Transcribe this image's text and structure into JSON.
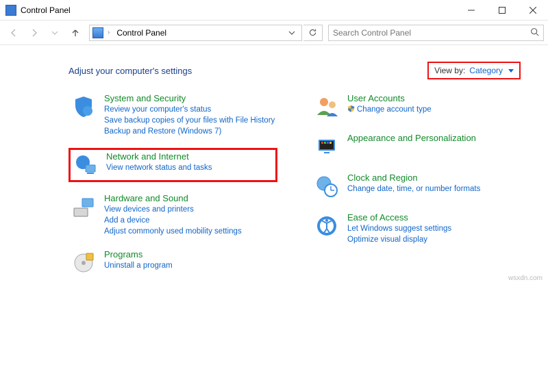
{
  "window": {
    "title": "Control Panel"
  },
  "breadcrumb": {
    "root": "Control Panel"
  },
  "search": {
    "placeholder": "Search Control Panel"
  },
  "header": {
    "title": "Adjust your computer's settings"
  },
  "viewby": {
    "label": "View by:",
    "value": "Category"
  },
  "left": [
    {
      "id": "system-security",
      "title": "System and Security",
      "links": [
        "Review your computer's status",
        "Save backup copies of your files with File History",
        "Backup and Restore (Windows 7)"
      ],
      "highlighted": false
    },
    {
      "id": "network-internet",
      "title": "Network and Internet",
      "links": [
        "View network status and tasks"
      ],
      "highlighted": true
    },
    {
      "id": "hardware-sound",
      "title": "Hardware and Sound",
      "links": [
        "View devices and printers",
        "Add a device",
        "Adjust commonly used mobility settings"
      ],
      "highlighted": false
    },
    {
      "id": "programs",
      "title": "Programs",
      "links": [
        "Uninstall a program"
      ],
      "highlighted": false
    }
  ],
  "right": [
    {
      "id": "user-accounts",
      "title": "User Accounts",
      "links": [
        "Change account type"
      ]
    },
    {
      "id": "appearance-personalization",
      "title": "Appearance and Personalization",
      "links": []
    },
    {
      "id": "clock-region",
      "title": "Clock and Region",
      "links": [
        "Change date, time, or number formats"
      ]
    },
    {
      "id": "ease-of-access",
      "title": "Ease of Access",
      "links": [
        "Let Windows suggest settings",
        "Optimize visual display"
      ]
    }
  ],
  "watermark": "wsxdn.com"
}
